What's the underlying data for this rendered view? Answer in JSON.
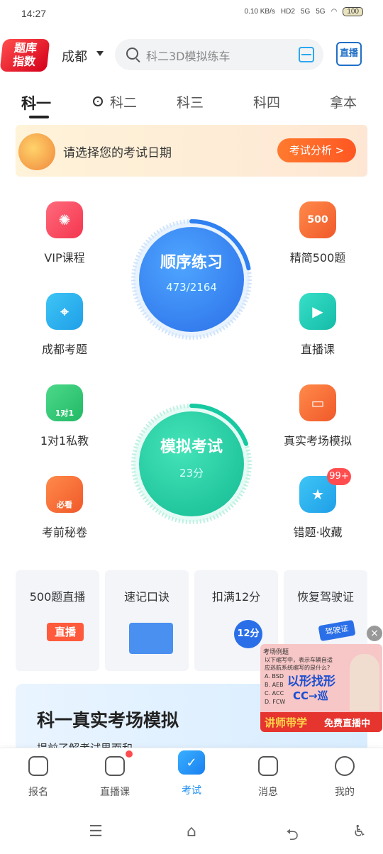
{
  "status": {
    "time": "14:27",
    "net": "0.10 KB/s",
    "hd": "HD2",
    "sig1": "5G",
    "sig2": "5G",
    "battery": "100"
  },
  "header": {
    "logo": [
      "题库",
      "指数"
    ],
    "city": "成都",
    "search_placeholder": "科二3D模拟练车",
    "live_label": "直播"
  },
  "tabs": [
    "科一",
    "科二",
    "科三",
    "科四",
    "拿本"
  ],
  "banner": {
    "text": "请选择您的考试日期",
    "button": "考试分析 >"
  },
  "features": {
    "vip": "VIP课程",
    "jingjian": "精简500题",
    "jingjian_badge": "500",
    "chengdu": "成都考题",
    "zhibo": "直播课",
    "private": "1对1私教",
    "private_badge": "1对1",
    "real_exam": "真实考场模拟",
    "secret": "考前秘卷",
    "secret_badge": "必看",
    "wrong": "错题·收藏",
    "wrong_badge": "99+"
  },
  "practice": {
    "title": "顺序练习",
    "progress": "473/2164",
    "progress_fraction": 0.219
  },
  "mock": {
    "title": "模拟考试",
    "score": "23分"
  },
  "cards": [
    {
      "title": "500题直播",
      "art": "直播"
    },
    {
      "title": "速记口诀",
      "art": ""
    },
    {
      "title": "扣满12分",
      "art": "12分"
    },
    {
      "title": "恢复驾驶证",
      "art": "驾驶证"
    }
  ],
  "promo": {
    "title": "科一真实考场模拟",
    "subtitle": "提前了解考试界面和"
  },
  "ad": {
    "header": "考场例题",
    "question": "以下缩写中，表示车辆自适应巡航系统缩写的是什么?",
    "options": [
      "A. BSD",
      "B. AEB",
      "C. ACC",
      "D. FCW"
    ],
    "headline": "以形找形",
    "formula": "CC→巡",
    "left": "讲师带学",
    "right": "免费直播中",
    "close": "×"
  },
  "bottom_nav": [
    {
      "label": "报名",
      "icon": "form-icon"
    },
    {
      "label": "直播课",
      "icon": "tv-icon"
    },
    {
      "label": "考试",
      "icon": "check-icon"
    },
    {
      "label": "消息",
      "icon": "message-icon"
    },
    {
      "label": "我的",
      "icon": "smile-icon"
    }
  ],
  "colors": {
    "accent": "#1a8cf0",
    "practice": "#2f80f0",
    "mock": "#17c9a0",
    "badge": "#ff4d4f"
  }
}
